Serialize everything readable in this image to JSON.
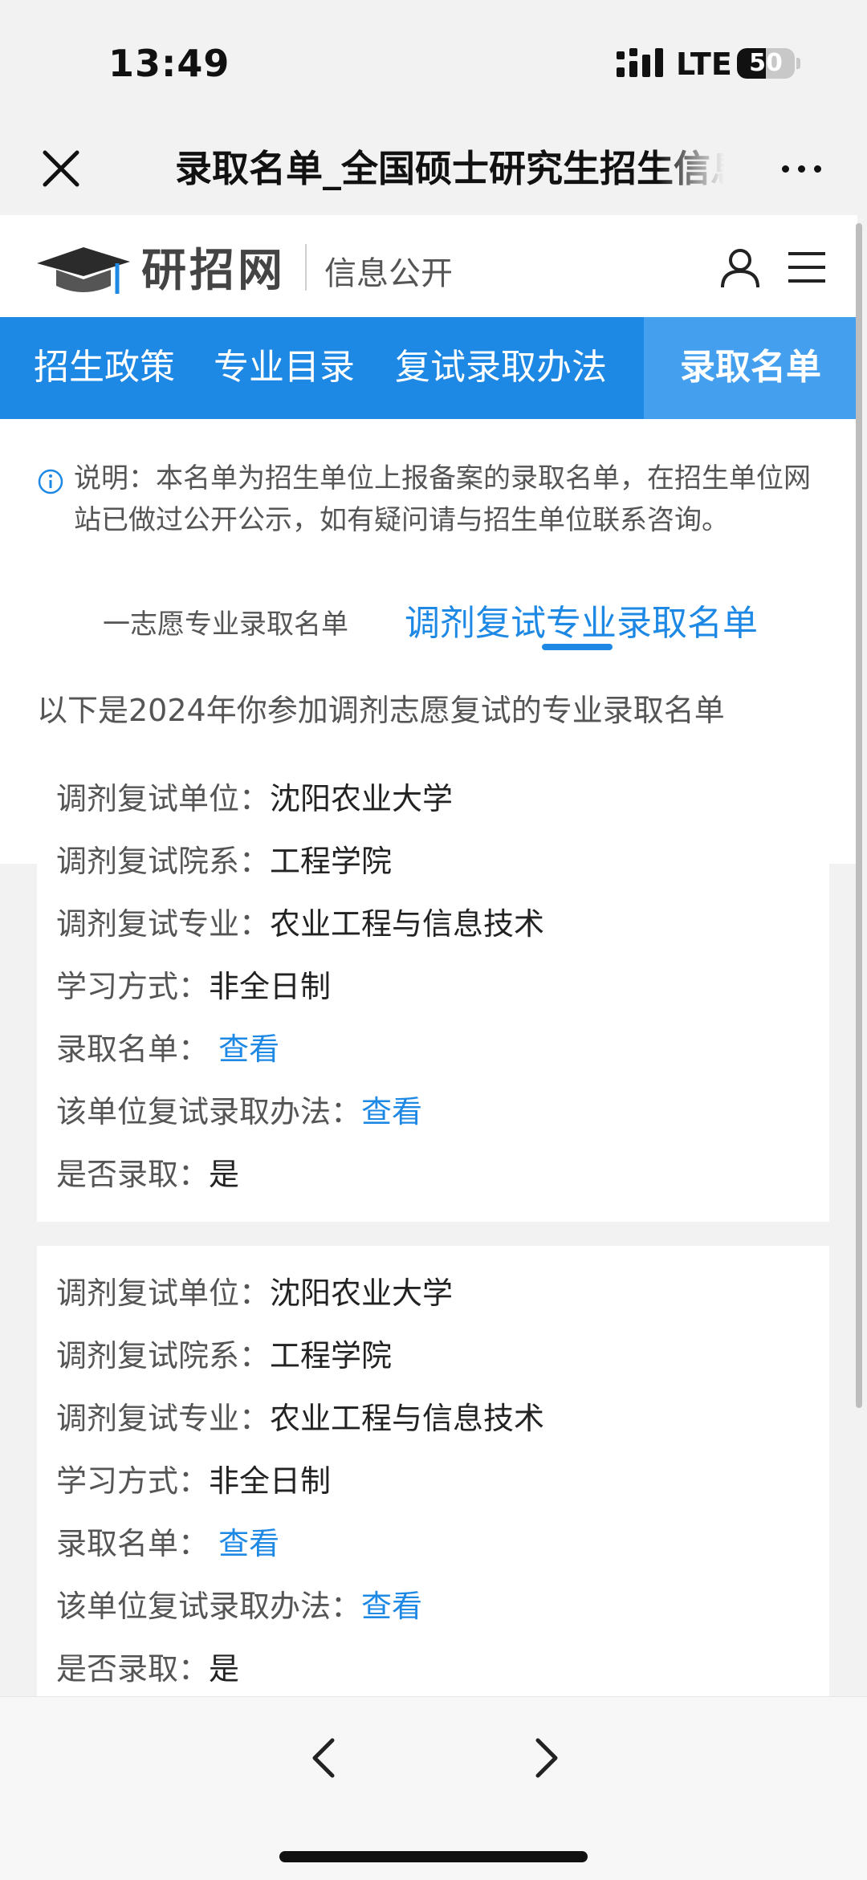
{
  "status": {
    "time": "13:49",
    "network": "LTE",
    "battery": "50",
    "battery_level": 0.5
  },
  "browser": {
    "title": "录取名单_全国硕士研究生招生信息公开平台"
  },
  "site": {
    "logo_text": "研招网",
    "logo_sub": "信息公开"
  },
  "nav": {
    "items": [
      "招生政策",
      "专业目录",
      "复试录取办法",
      "录取名单"
    ],
    "active": 3
  },
  "notice": {
    "text": "说明：本名单为招生单位上报备案的录取名单，在招生单位网站已做过公开公示，如有疑问请与招生单位联系咨询。"
  },
  "sub_tabs": {
    "items": [
      "一志愿专业录取名单",
      "调剂复试专业录取名单"
    ],
    "active": 1
  },
  "intro": "以下是2024年你参加调剂志愿复试的专业录取名单",
  "records": [
    {
      "unit_label": "调剂复试单位：",
      "unit": "沈阳农业大学",
      "dept_label": "调剂复试院系：",
      "dept": "工程学院",
      "major_label": "调剂复试专业：",
      "major": "农业工程与信息技术",
      "mode_label": "学习方式：",
      "mode": "非全日制",
      "list_label": "录取名单：",
      "list_link": "查看",
      "method_label": "该单位复试录取办法：",
      "method_link": "查看",
      "admitted_label": "是否录取：",
      "admitted": "是"
    },
    {
      "unit_label": "调剂复试单位：",
      "unit": "沈阳农业大学",
      "dept_label": "调剂复试院系：",
      "dept": "工程学院",
      "major_label": "调剂复试专业：",
      "major": "农业工程与信息技术",
      "mode_label": "学习方式：",
      "mode": "非全日制",
      "list_label": "录取名单：",
      "list_link": "查看",
      "method_label": "该单位复试录取办法：",
      "method_link": "查看",
      "admitted_label": "是否录取：",
      "admitted": "是"
    }
  ],
  "colors": {
    "accent": "#1e88e5",
    "nav_active": "#449fee",
    "background": "#f2f2f2"
  }
}
